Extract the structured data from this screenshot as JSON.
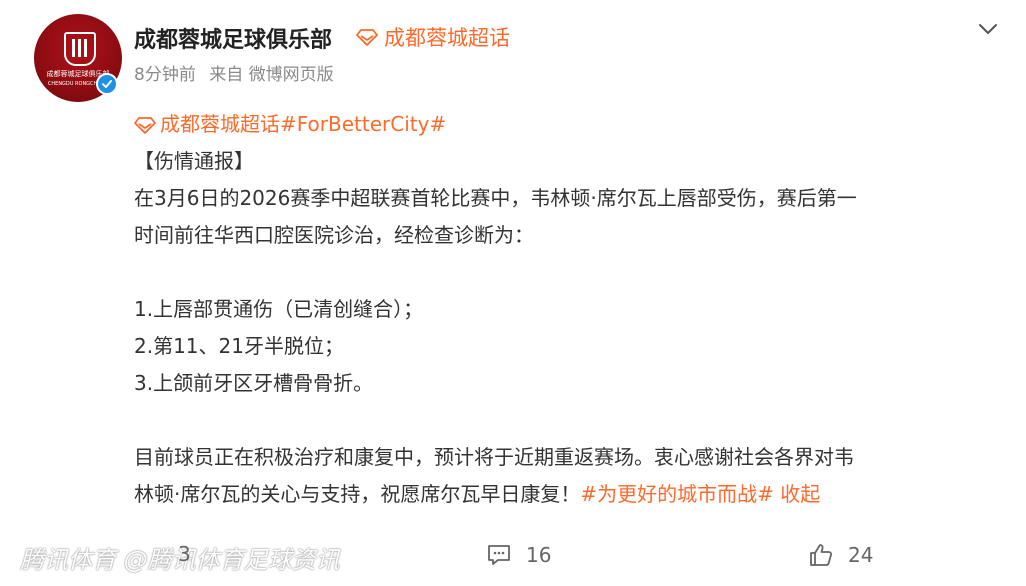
{
  "header": {
    "avatar_text": "成都蓉城足球俱乐部",
    "avatar_subtext": "CHENGDU RONGCHENG",
    "username": "成都蓉城足球俱乐部",
    "super_topic": "成都蓉城超话",
    "time": "8分钟前",
    "source": "来自 微博网页版"
  },
  "post": {
    "topic_tag": "成都蓉城超话#ForBetterCity#",
    "heading": "【伤情通报】",
    "para1_line1": "在3月6日的2026赛季中超联赛首轮比赛中，韦林顿·席尔瓦上唇部受伤，赛后第一",
    "para1_line2": "时间前往华西口腔医院诊治，经检查诊断为：",
    "items": [
      "1.上唇部贯通伤（已清创缝合）；",
      "2.第11、21牙半脱位；",
      "3.上颌前牙区牙槽骨骨折。"
    ],
    "para2_line1": "目前球员正在积极治疗和康复中，预计将于近期重返赛场。衷心感谢社会各界对韦",
    "para2_line2_text": "林顿·席尔瓦的关心与支持，祝愿席尔瓦早日康复！",
    "para2_hashtag": "#为更好的城市而战#",
    "collapse_label": "收起"
  },
  "footer": {
    "watermark": "腾讯体育 @腾讯体育足球资讯",
    "share_count": "3",
    "comment_count": "16",
    "like_count": "24"
  },
  "colors": {
    "accent": "#ff6a2b",
    "verified": "#1e90e6",
    "brand_red": "#8c0c12"
  }
}
